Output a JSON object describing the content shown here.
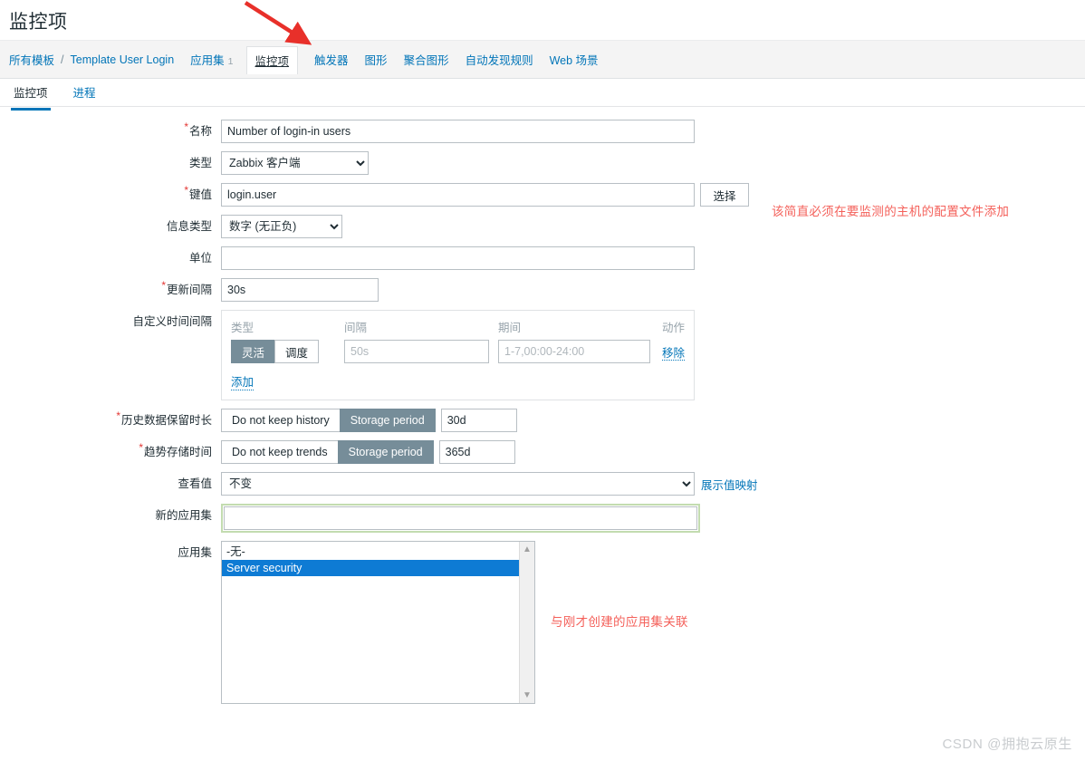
{
  "page": {
    "title": "监控项"
  },
  "breadcrumb": {
    "all_templates": "所有模板",
    "separator": "/",
    "template_name": "Template User Login",
    "items": [
      {
        "label": "应用集",
        "count": "1"
      },
      {
        "label": "监控项",
        "count": ""
      },
      {
        "label": "触发器",
        "count": ""
      },
      {
        "label": "图形",
        "count": ""
      },
      {
        "label": "聚合图形",
        "count": ""
      },
      {
        "label": "自动发现规则",
        "count": ""
      },
      {
        "label": "Web 场景",
        "count": ""
      }
    ],
    "active_label": "监控项"
  },
  "subtabs": [
    {
      "label": "监控项",
      "active": true
    },
    {
      "label": "进程",
      "active": false
    }
  ],
  "form": {
    "name": {
      "label": "名称",
      "required": true,
      "value": "Number of login-in users"
    },
    "type": {
      "label": "类型",
      "required": false,
      "value": "Zabbix 客户端"
    },
    "key": {
      "label": "键值",
      "required": true,
      "value": "login.user",
      "select_button": "选择"
    },
    "value_type": {
      "label": "信息类型",
      "required": false,
      "value": "数字 (无正负)"
    },
    "units": {
      "label": "单位",
      "required": false,
      "value": ""
    },
    "update_interval": {
      "label": "更新间隔",
      "required": true,
      "value": "30s"
    },
    "custom_intervals": {
      "label": "自定义时间间隔",
      "required": false,
      "headers": {
        "type": "类型",
        "interval": "间隔",
        "period": "期间",
        "action": "动作"
      },
      "rows": [
        {
          "type_flexible": "灵活",
          "type_scheduling": "调度",
          "type_selected": "灵活",
          "interval_value": "",
          "interval_placeholder": "50s",
          "period_value": "",
          "period_placeholder": "1-7,00:00-24:00",
          "remove_label": "移除"
        }
      ],
      "add_label": "添加"
    },
    "history": {
      "label": "历史数据保留时长",
      "required": true,
      "off_label": "Do not keep history",
      "on_label": "Storage period",
      "selected": "Storage period",
      "value": "30d"
    },
    "trends": {
      "label": "趋势存储时间",
      "required": true,
      "off_label": "Do not keep trends",
      "on_label": "Storage period",
      "selected": "Storage period",
      "value": "365d"
    },
    "view_value": {
      "label": "查看值",
      "required": false,
      "value": "不变",
      "link_label": "展示值映射"
    },
    "new_application": {
      "label": "新的应用集",
      "required": false,
      "value": "",
      "highlighted": true
    },
    "applications": {
      "label": "应用集",
      "required": false,
      "options": [
        {
          "label": "-无-",
          "selected": false
        },
        {
          "label": "Server security",
          "selected": true
        }
      ],
      "scroll_up_icon": "chevron-up-icon",
      "scroll_down_icon": "chevron-down-icon"
    }
  },
  "annotations": {
    "key_note": "该简直必须在要监测的主机的配置文件添加",
    "application_note": "与刚才创建的应用集关联",
    "arrow_icon": "red-arrow-icon",
    "arrow_color": "#e8302a"
  },
  "watermark": {
    "text": "CSDN @拥抱云原生"
  },
  "colors": {
    "link": "#0275b8",
    "required_star": "#e33734",
    "toggle_active_bg": "#768d99",
    "list_selection_bg": "#0e7bd4",
    "annotation": "#f4605a",
    "highlight_border": "#c3dcb0"
  }
}
